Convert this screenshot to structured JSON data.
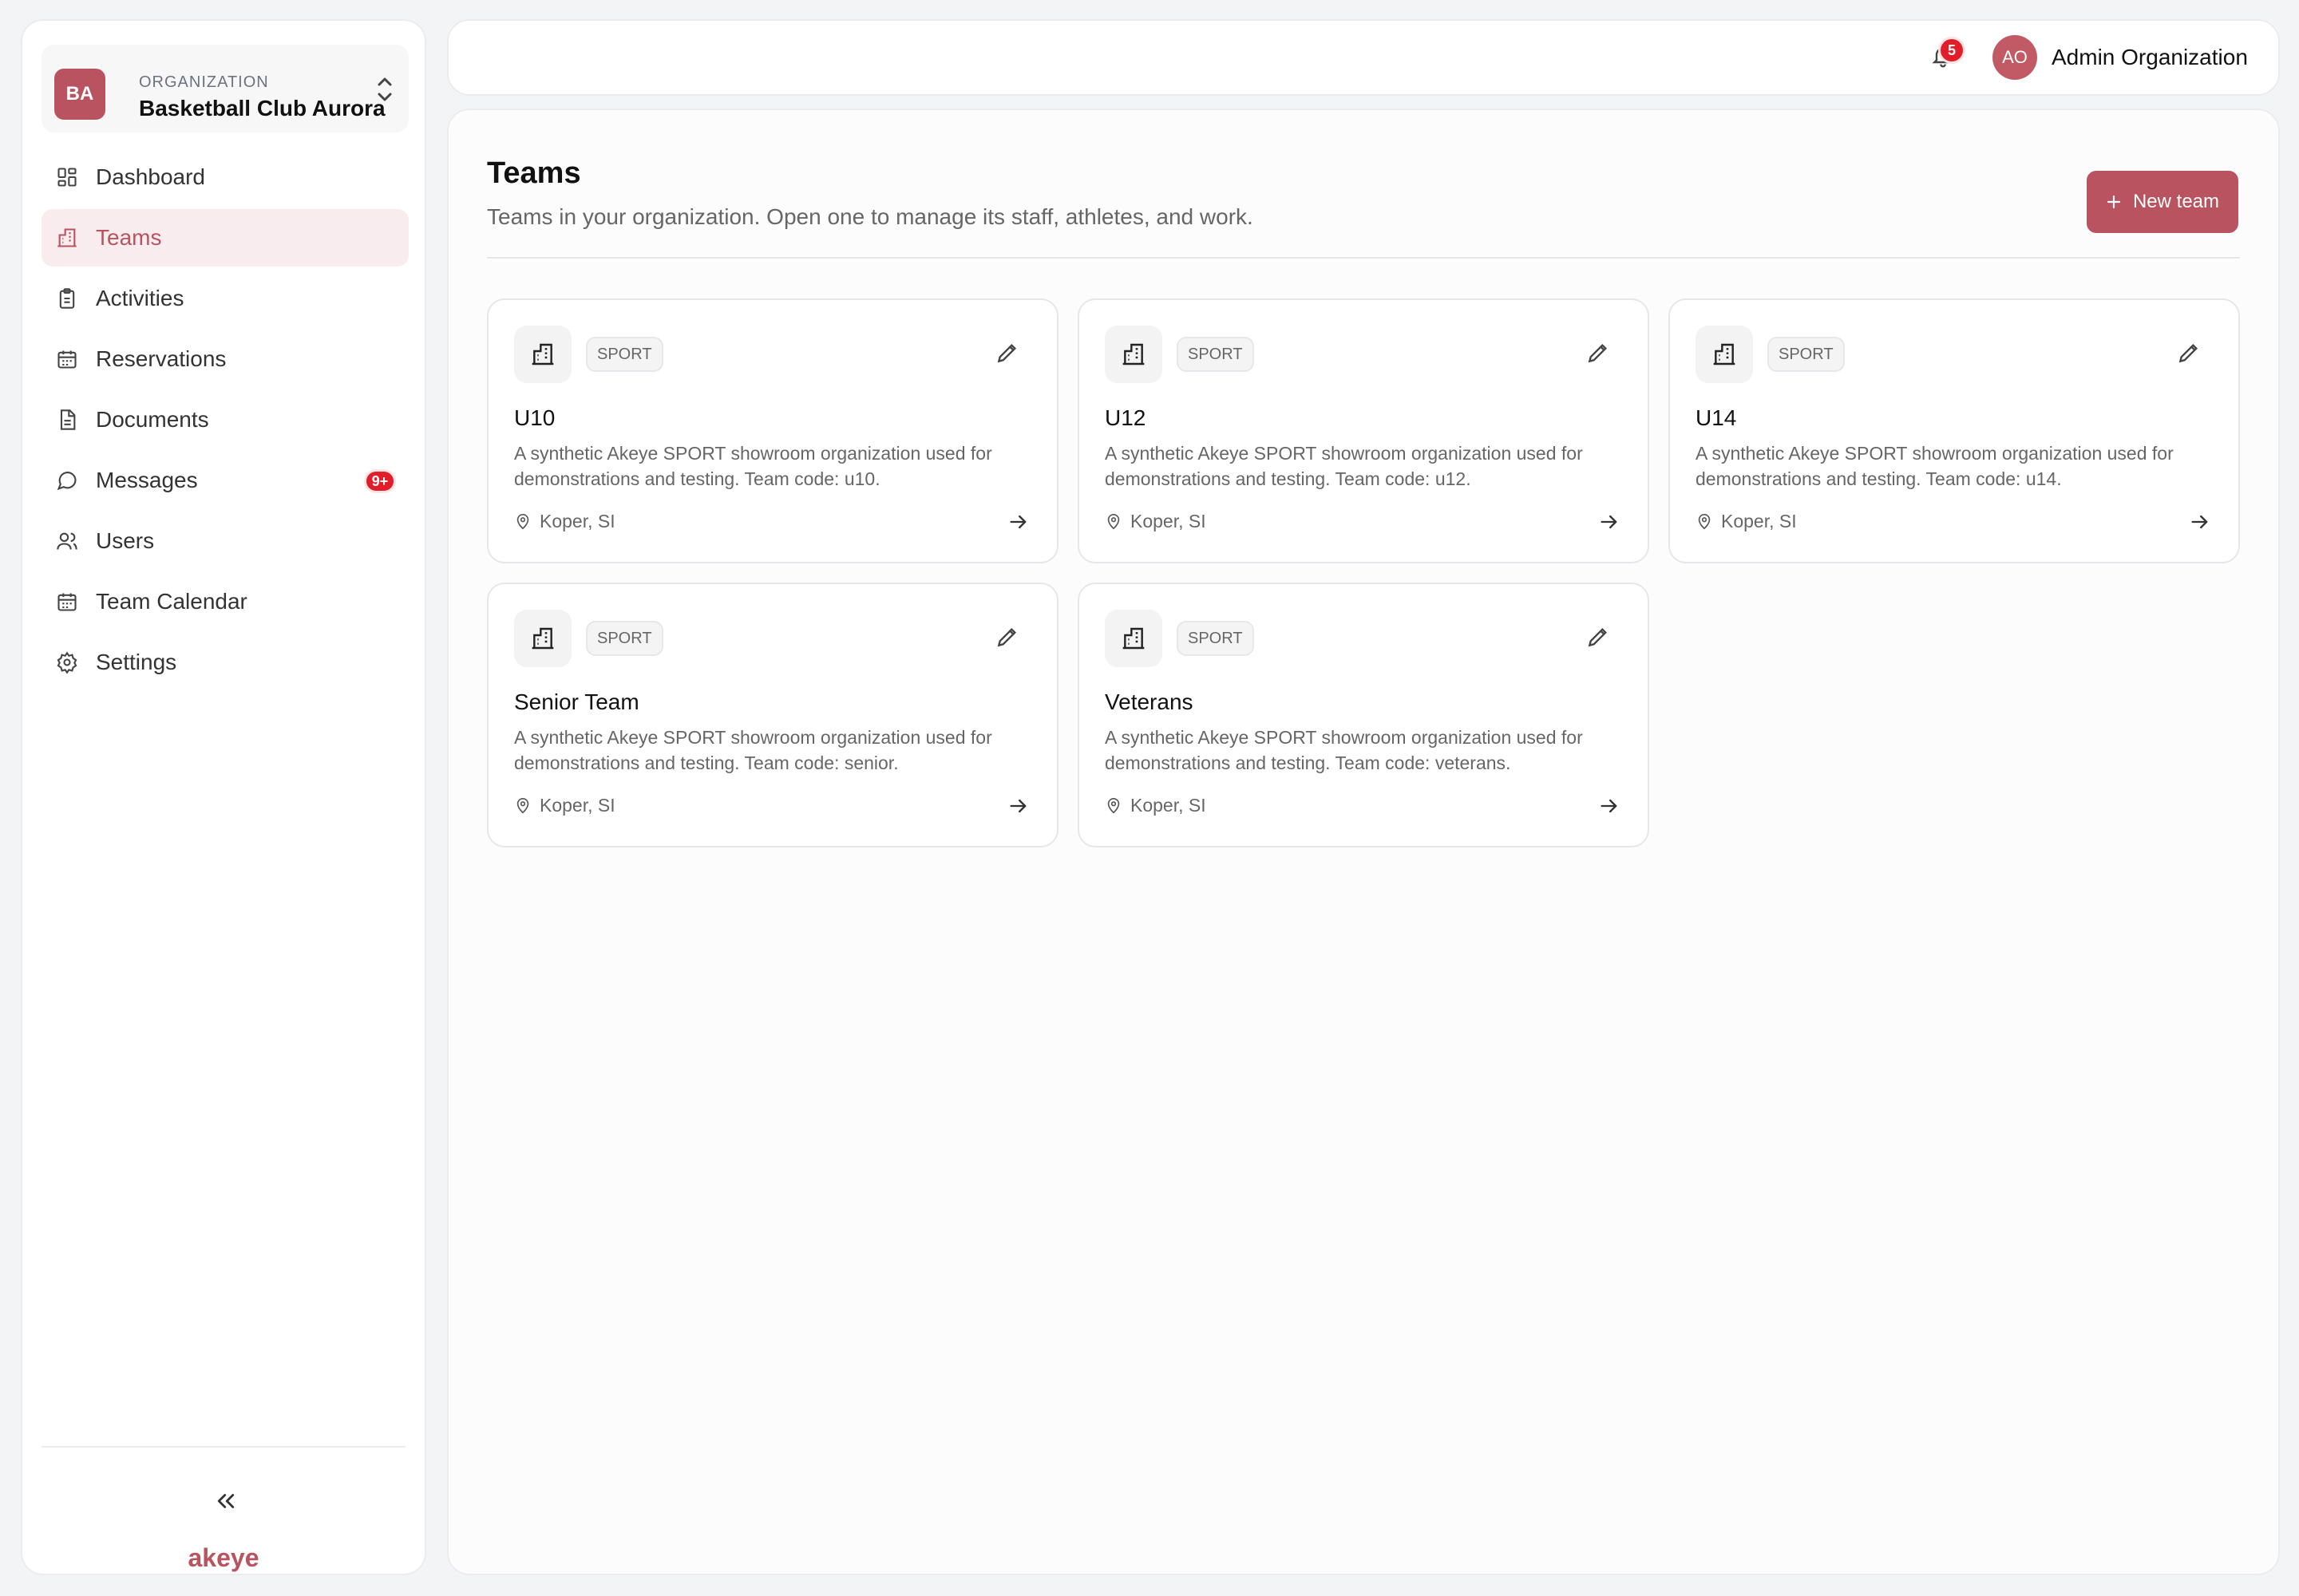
{
  "sidebar": {
    "org": {
      "badge": "BA",
      "kicker": "ORGANIZATION",
      "name": "Basketball Club Aurora"
    },
    "nav": [
      {
        "label": "Dashboard",
        "icon": "dashboard-icon",
        "active": false
      },
      {
        "label": "Teams",
        "icon": "teams-icon",
        "active": true
      },
      {
        "label": "Activities",
        "icon": "clipboard-icon",
        "active": false
      },
      {
        "label": "Reservations",
        "icon": "calendar-icon",
        "active": false
      },
      {
        "label": "Documents",
        "icon": "document-icon",
        "active": false
      },
      {
        "label": "Messages",
        "icon": "message-icon",
        "active": false,
        "badge": "9+"
      },
      {
        "label": "Users",
        "icon": "users-icon",
        "active": false
      },
      {
        "label": "Team Calendar",
        "icon": "calendar-icon",
        "active": false
      },
      {
        "label": "Settings",
        "icon": "gear-icon",
        "active": false
      }
    ],
    "brand": "akeye"
  },
  "topbar": {
    "notification_count": "5",
    "user_initials": "AO",
    "user_name": "Admin Organization"
  },
  "main": {
    "title": "Teams",
    "subtitle": "Teams in your organization. Open one to manage its staff, athletes, and work.",
    "new_team_label": "New team",
    "cards": [
      {
        "tag": "SPORT",
        "title": "U10",
        "description": "A synthetic Akeye SPORT showroom organization used for demonstrations and testing. Team code: u10.",
        "location": "Koper, SI"
      },
      {
        "tag": "SPORT",
        "title": "U12",
        "description": "A synthetic Akeye SPORT showroom organization used for demonstrations and testing. Team code: u12.",
        "location": "Koper, SI"
      },
      {
        "tag": "SPORT",
        "title": "U14",
        "description": "A synthetic Akeye SPORT showroom organization used for demonstrations and testing. Team code: u14.",
        "location": "Koper, SI"
      },
      {
        "tag": "SPORT",
        "title": "Senior Team",
        "description": "A synthetic Akeye SPORT showroom organization used for demonstrations and testing. Team code: senior.",
        "location": "Koper, SI"
      },
      {
        "tag": "SPORT",
        "title": "Veterans",
        "description": "A synthetic Akeye SPORT showroom organization used for demonstrations and testing. Team code: veterans.",
        "location": "Koper, SI"
      }
    ]
  },
  "colors": {
    "accent": "#b9535f",
    "active_nav_bg": "#f8ecee",
    "badge_red": "#e11d2a"
  }
}
